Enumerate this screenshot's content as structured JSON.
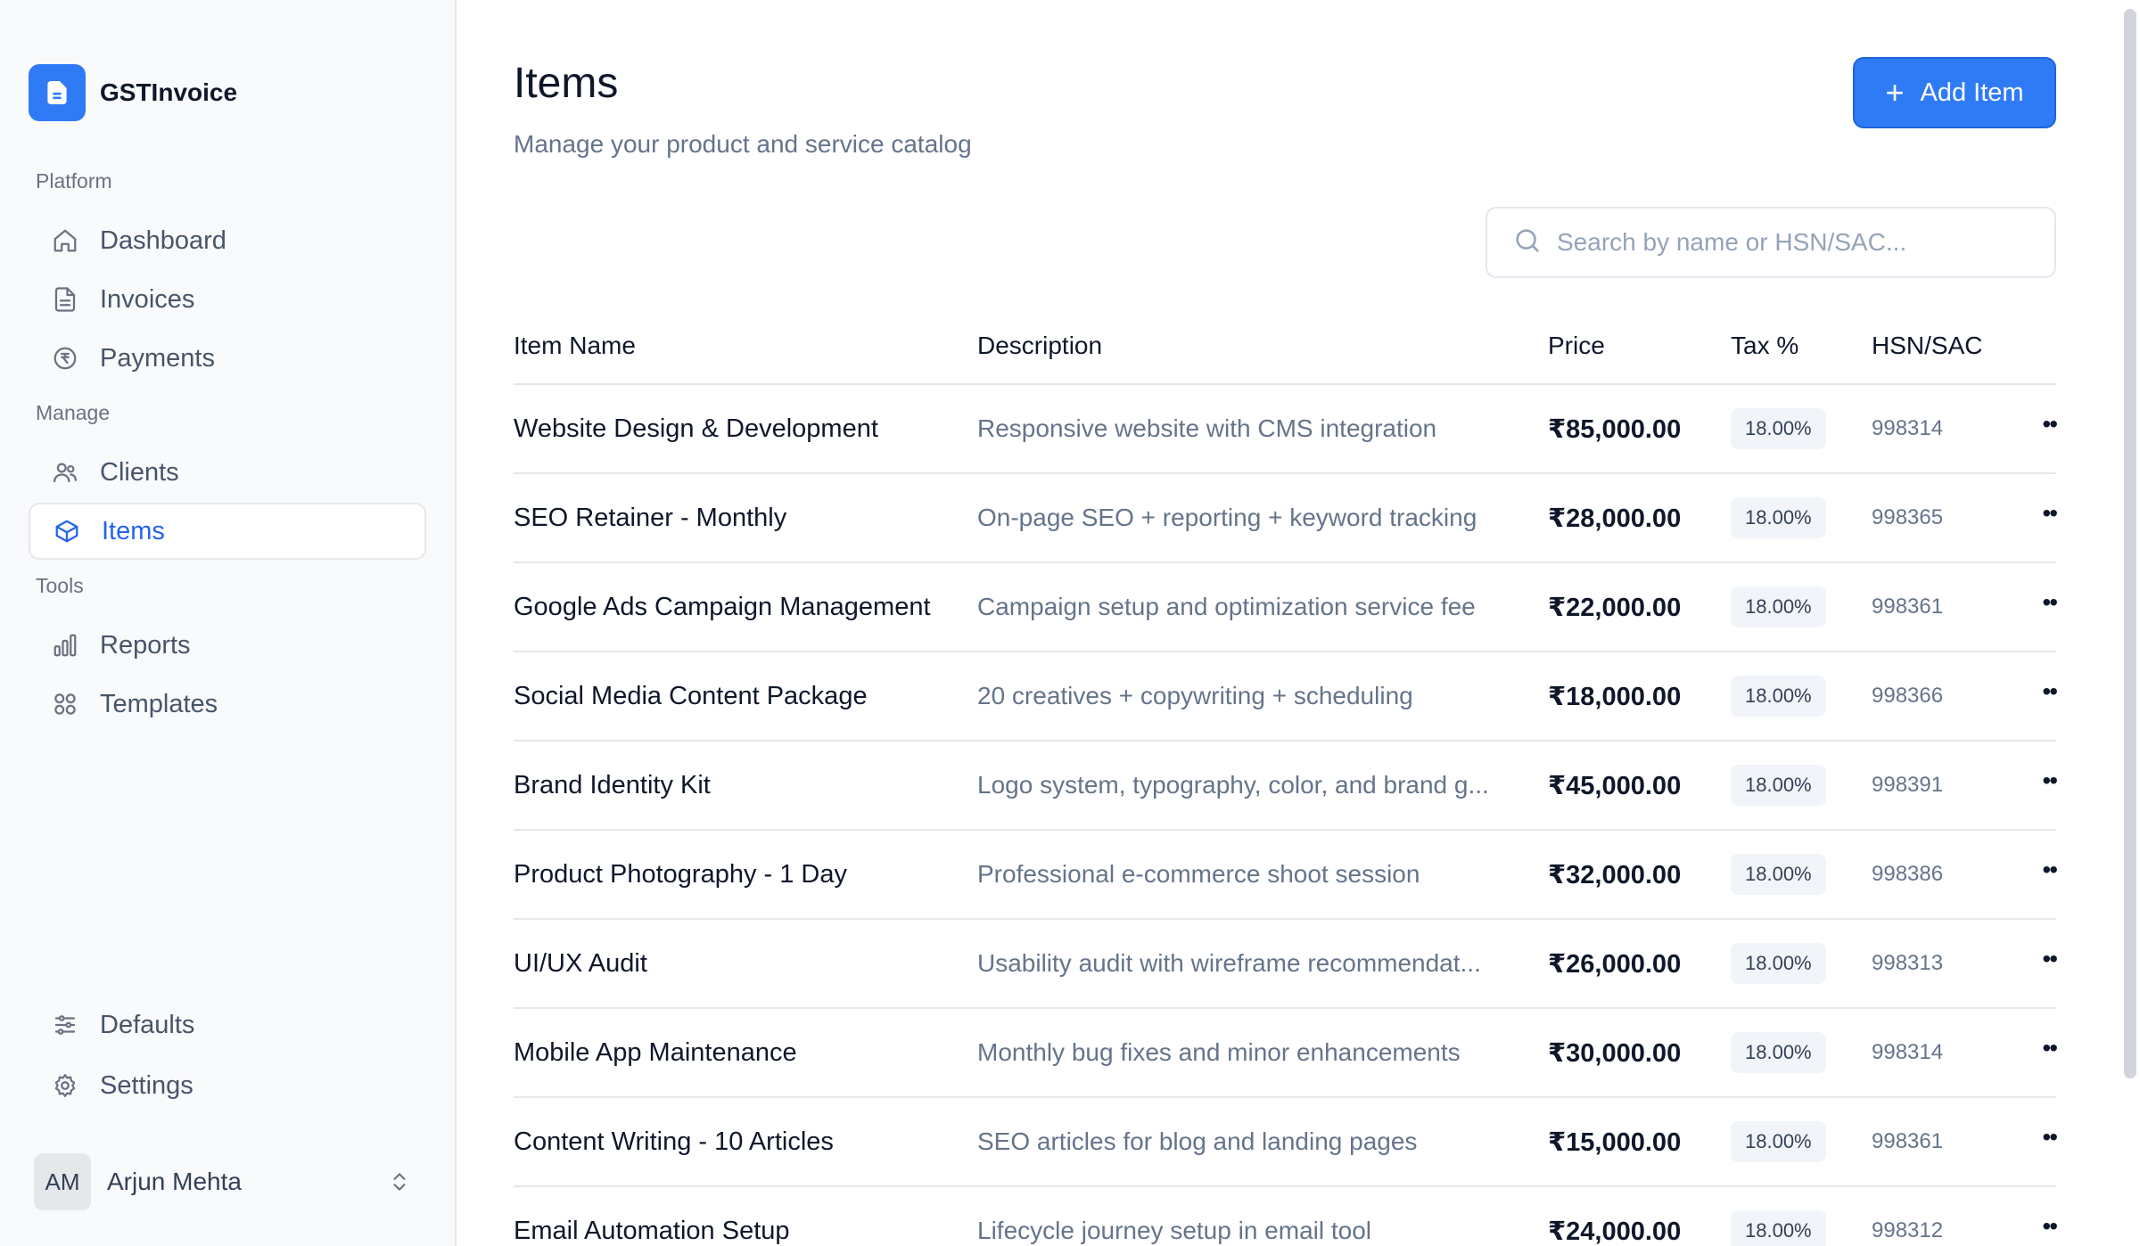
{
  "brand": {
    "name": "GSTInvoice"
  },
  "sidebar": {
    "sections": {
      "platform": "Platform",
      "manage": "Manage",
      "tools": "Tools"
    },
    "items": [
      {
        "label": "Dashboard",
        "icon": "home-icon"
      },
      {
        "label": "Invoices",
        "icon": "file-icon"
      },
      {
        "label": "Payments",
        "icon": "rupee-circle-icon"
      },
      {
        "label": "Clients",
        "icon": "users-icon"
      },
      {
        "label": "Items",
        "icon": "box-icon",
        "active": true
      },
      {
        "label": "Reports",
        "icon": "bar-chart-icon"
      },
      {
        "label": "Templates",
        "icon": "grid-icon"
      },
      {
        "label": "Defaults",
        "icon": "sliders-icon"
      },
      {
        "label": "Settings",
        "icon": "gear-icon"
      }
    ],
    "user": {
      "initials": "AM",
      "name": "Arjun Mehta"
    }
  },
  "header": {
    "title": "Items",
    "subtitle": "Manage your product and service catalog",
    "add_label": "Add Item"
  },
  "search": {
    "placeholder": "Search by name or HSN/SAC...",
    "value": ""
  },
  "table": {
    "columns": [
      "Item Name",
      "Description",
      "Price",
      "Tax %",
      "HSN/SAC"
    ],
    "rows": [
      {
        "name": "Website Design & Development",
        "description": "Responsive website with CMS integration",
        "price": "₹85,000.00",
        "tax": "18.00%",
        "hsn": "998314"
      },
      {
        "name": "SEO Retainer - Monthly",
        "description": "On-page SEO + reporting + keyword tracking",
        "price": "₹28,000.00",
        "tax": "18.00%",
        "hsn": "998365"
      },
      {
        "name": "Google Ads Campaign Management",
        "description": "Campaign setup and optimization service fee",
        "price": "₹22,000.00",
        "tax": "18.00%",
        "hsn": "998361"
      },
      {
        "name": "Social Media Content Package",
        "description": "20 creatives + copywriting + scheduling",
        "price": "₹18,000.00",
        "tax": "18.00%",
        "hsn": "998366"
      },
      {
        "name": "Brand Identity Kit",
        "description": "Logo system, typography, color, and brand g...",
        "price": "₹45,000.00",
        "tax": "18.00%",
        "hsn": "998391"
      },
      {
        "name": "Product Photography - 1 Day",
        "description": "Professional e-commerce shoot session",
        "price": "₹32,000.00",
        "tax": "18.00%",
        "hsn": "998386"
      },
      {
        "name": "UI/UX Audit",
        "description": "Usability audit with wireframe recommendat...",
        "price": "₹26,000.00",
        "tax": "18.00%",
        "hsn": "998313"
      },
      {
        "name": "Mobile App Maintenance",
        "description": "Monthly bug fixes and minor enhancements",
        "price": "₹30,000.00",
        "tax": "18.00%",
        "hsn": "998314"
      },
      {
        "name": "Content Writing - 10 Articles",
        "description": "SEO articles for blog and landing pages",
        "price": "₹15,000.00",
        "tax": "18.00%",
        "hsn": "998361"
      },
      {
        "name": "Email Automation Setup",
        "description": "Lifecycle journey setup in email tool",
        "price": "₹24,000.00",
        "tax": "18.00%",
        "hsn": "998312"
      }
    ]
  },
  "colors": {
    "accent": "#2f7bf5",
    "active_text": "#2563eb",
    "sidebar_bg": "#f8fafc"
  }
}
